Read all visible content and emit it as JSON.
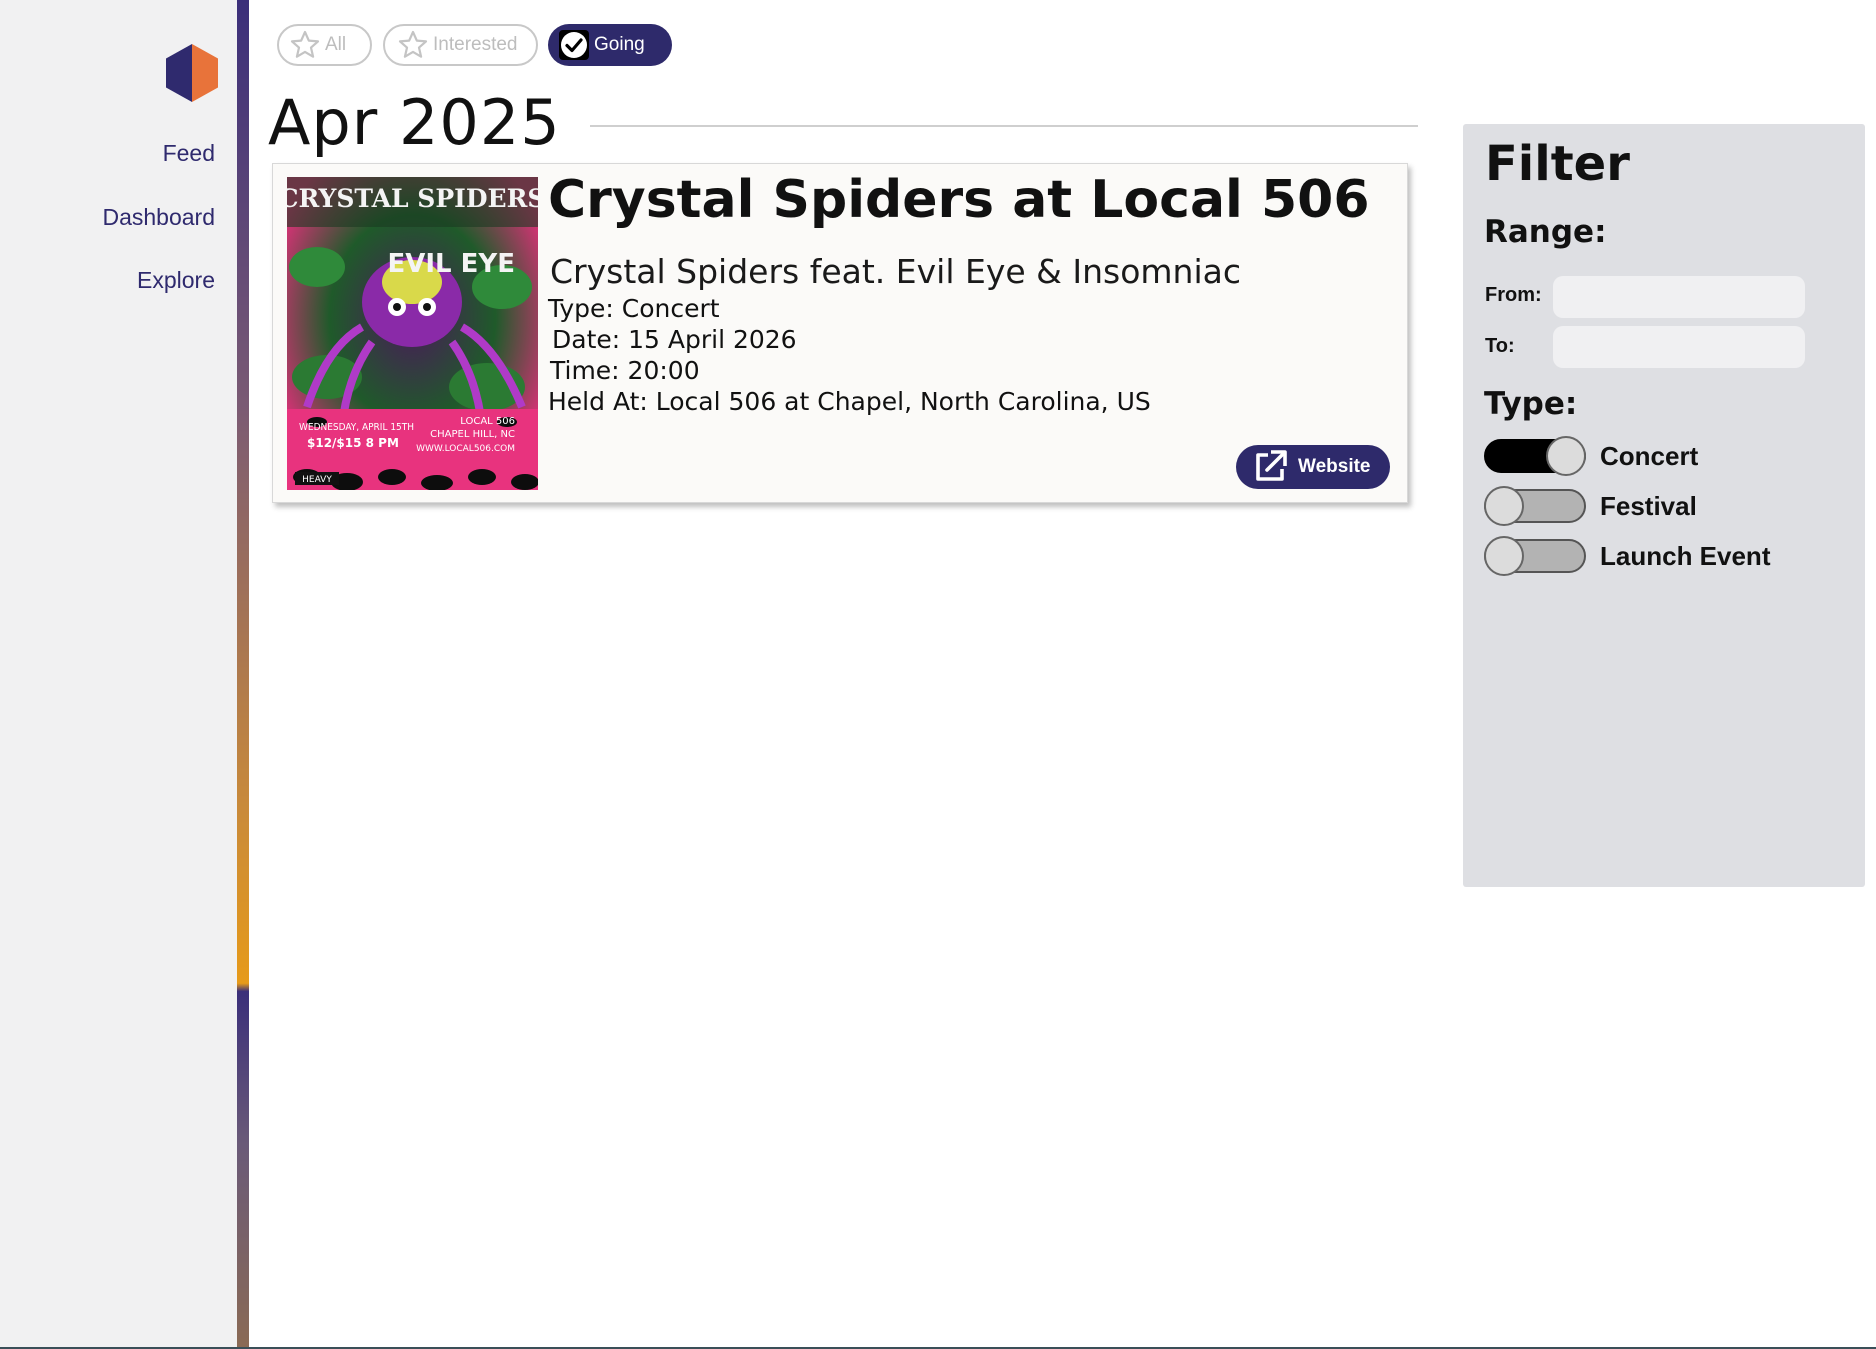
{
  "sidebar": {
    "logo": "hexagon-logo",
    "items": [
      {
        "label": "Feed"
      },
      {
        "label": "Dashboard"
      },
      {
        "label": "Explore"
      }
    ]
  },
  "filters_bar": {
    "pills": [
      {
        "label": "All",
        "icon": "star-outline-icon",
        "active": false
      },
      {
        "label": "Interested",
        "icon": "star-outline-icon",
        "active": false
      },
      {
        "label": "Going",
        "icon": "check-circle-icon",
        "active": true
      }
    ]
  },
  "month": {
    "title": "Apr 2025"
  },
  "event": {
    "title": "Crystal Spiders at Local 506",
    "subtitle": "Crystal Spiders feat. Evil Eye & Insomniac",
    "type": "Type: Concert",
    "date": "Date: 15 April 2026",
    "time": "Time: 20:00",
    "held_at": "Held At: Local 506 at Chapel, North Carolina, US",
    "website_label": "Website",
    "poster": {
      "headline": "CRYSTAL SPIDERS",
      "guest": "EVIL EYE",
      "date_line": "WEDNESDAY, APRIL 15TH",
      "venue_line1": "LOCAL 506",
      "venue_line2": "CHAPEL HILL, NC",
      "price_time": "$12/$15    8 PM",
      "url": "WWW.LOCAL506.COM",
      "badge": "HEAVY"
    }
  },
  "filter": {
    "title": "Filter",
    "range_label": "Range:",
    "from_label": "From:",
    "to_label": "To:",
    "from_value": "",
    "to_value": "",
    "type_label": "Type:",
    "types": [
      {
        "label": "Concert",
        "on": true
      },
      {
        "label": "Festival",
        "on": false
      },
      {
        "label": "Launch Event",
        "on": false
      }
    ]
  },
  "colors": {
    "brand_primary": "#2e2a6b",
    "brand_accent": "#e8733a",
    "sidebar_bg": "#f1f1f2",
    "filter_bg": "#dedfe3"
  }
}
